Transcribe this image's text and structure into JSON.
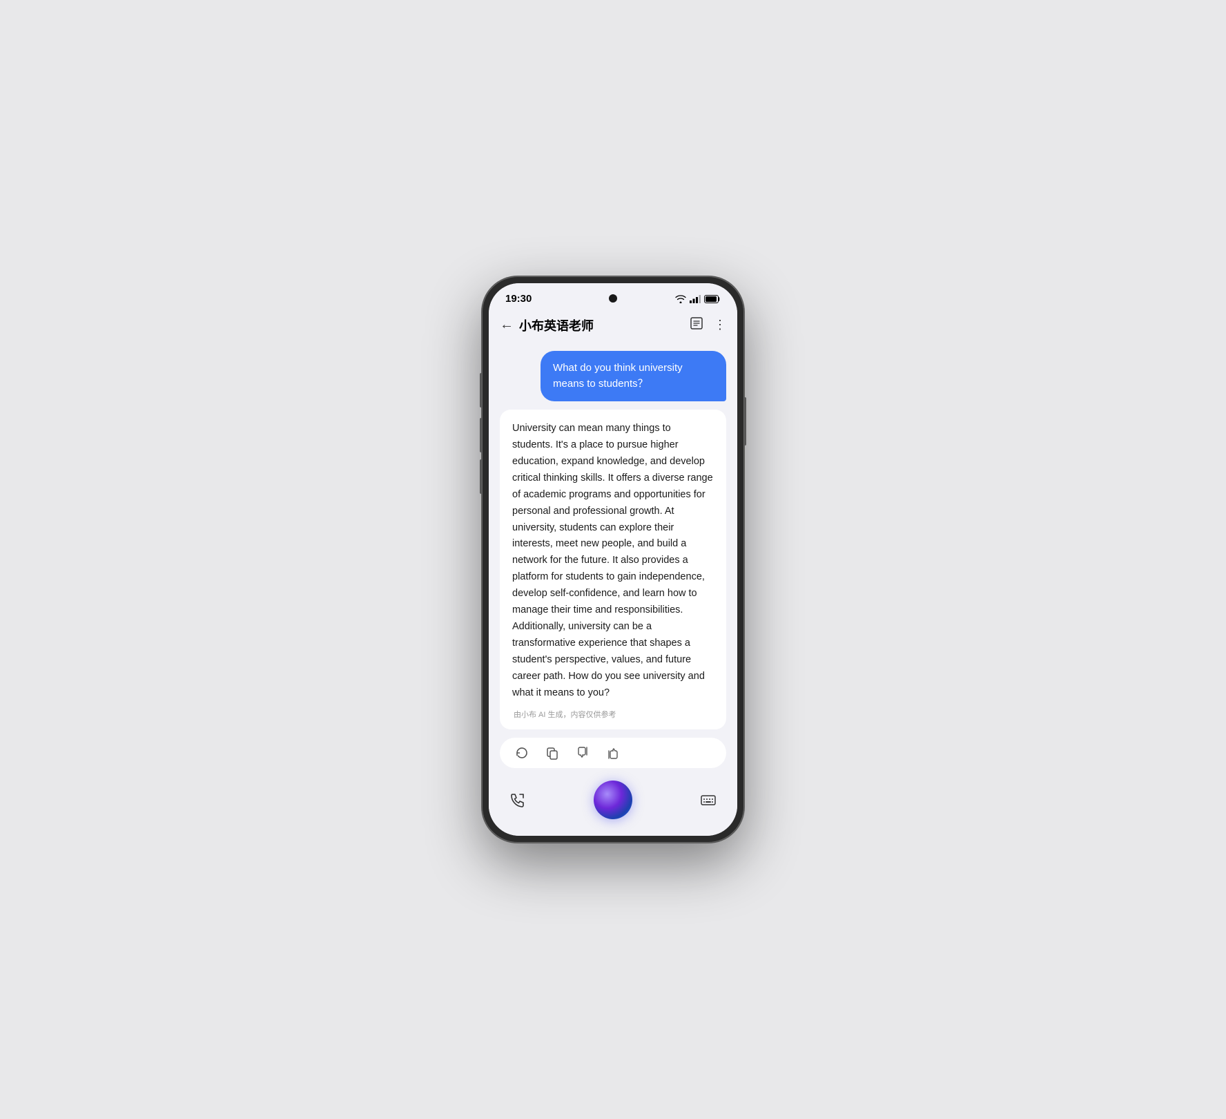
{
  "phone": {
    "status": {
      "time": "19:30"
    },
    "header": {
      "back_label": "←",
      "title": "小布英语老师",
      "menu_icon": "⋮"
    },
    "chat": {
      "user_message": "What do you think university means to students？",
      "ai_response": "University can mean many things to students. It's a place to pursue higher education, expand knowledge, and develop critical thinking skills. It offers a diverse range of academic programs and opportunities for personal and professional growth. At university, students can explore their interests, meet new people, and build a network for the future. It also provides a platform for students to gain independence, develop self-confidence, and learn how to manage their time and responsibilities. Additionally, university can be a transformative experience that shapes a student's perspective, values, and future career path. How do you see university and what it means to you?",
      "ai_caption": "由小布 AI 生成，内容仅供参考"
    },
    "actions": {
      "refresh_label": "refresh",
      "copy_label": "copy",
      "dislike_label": "dislike",
      "like_label": "like"
    }
  }
}
